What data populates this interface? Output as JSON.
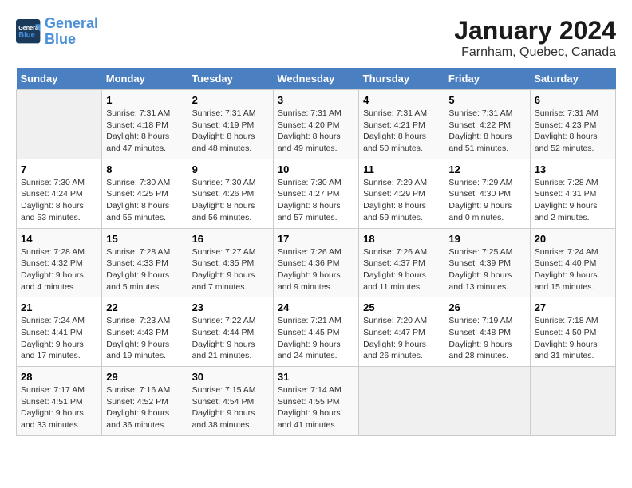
{
  "header": {
    "logo_line1": "General",
    "logo_line2": "Blue",
    "title": "January 2024",
    "subtitle": "Farnham, Quebec, Canada"
  },
  "weekdays": [
    "Sunday",
    "Monday",
    "Tuesday",
    "Wednesday",
    "Thursday",
    "Friday",
    "Saturday"
  ],
  "weeks": [
    [
      {
        "num": "",
        "info": ""
      },
      {
        "num": "1",
        "info": "Sunrise: 7:31 AM\nSunset: 4:18 PM\nDaylight: 8 hours\nand 47 minutes."
      },
      {
        "num": "2",
        "info": "Sunrise: 7:31 AM\nSunset: 4:19 PM\nDaylight: 8 hours\nand 48 minutes."
      },
      {
        "num": "3",
        "info": "Sunrise: 7:31 AM\nSunset: 4:20 PM\nDaylight: 8 hours\nand 49 minutes."
      },
      {
        "num": "4",
        "info": "Sunrise: 7:31 AM\nSunset: 4:21 PM\nDaylight: 8 hours\nand 50 minutes."
      },
      {
        "num": "5",
        "info": "Sunrise: 7:31 AM\nSunset: 4:22 PM\nDaylight: 8 hours\nand 51 minutes."
      },
      {
        "num": "6",
        "info": "Sunrise: 7:31 AM\nSunset: 4:23 PM\nDaylight: 8 hours\nand 52 minutes."
      }
    ],
    [
      {
        "num": "7",
        "info": "Sunrise: 7:30 AM\nSunset: 4:24 PM\nDaylight: 8 hours\nand 53 minutes."
      },
      {
        "num": "8",
        "info": "Sunrise: 7:30 AM\nSunset: 4:25 PM\nDaylight: 8 hours\nand 55 minutes."
      },
      {
        "num": "9",
        "info": "Sunrise: 7:30 AM\nSunset: 4:26 PM\nDaylight: 8 hours\nand 56 minutes."
      },
      {
        "num": "10",
        "info": "Sunrise: 7:30 AM\nSunset: 4:27 PM\nDaylight: 8 hours\nand 57 minutes."
      },
      {
        "num": "11",
        "info": "Sunrise: 7:29 AM\nSunset: 4:29 PM\nDaylight: 8 hours\nand 59 minutes."
      },
      {
        "num": "12",
        "info": "Sunrise: 7:29 AM\nSunset: 4:30 PM\nDaylight: 9 hours\nand 0 minutes."
      },
      {
        "num": "13",
        "info": "Sunrise: 7:28 AM\nSunset: 4:31 PM\nDaylight: 9 hours\nand 2 minutes."
      }
    ],
    [
      {
        "num": "14",
        "info": "Sunrise: 7:28 AM\nSunset: 4:32 PM\nDaylight: 9 hours\nand 4 minutes."
      },
      {
        "num": "15",
        "info": "Sunrise: 7:28 AM\nSunset: 4:33 PM\nDaylight: 9 hours\nand 5 minutes."
      },
      {
        "num": "16",
        "info": "Sunrise: 7:27 AM\nSunset: 4:35 PM\nDaylight: 9 hours\nand 7 minutes."
      },
      {
        "num": "17",
        "info": "Sunrise: 7:26 AM\nSunset: 4:36 PM\nDaylight: 9 hours\nand 9 minutes."
      },
      {
        "num": "18",
        "info": "Sunrise: 7:26 AM\nSunset: 4:37 PM\nDaylight: 9 hours\nand 11 minutes."
      },
      {
        "num": "19",
        "info": "Sunrise: 7:25 AM\nSunset: 4:39 PM\nDaylight: 9 hours\nand 13 minutes."
      },
      {
        "num": "20",
        "info": "Sunrise: 7:24 AM\nSunset: 4:40 PM\nDaylight: 9 hours\nand 15 minutes."
      }
    ],
    [
      {
        "num": "21",
        "info": "Sunrise: 7:24 AM\nSunset: 4:41 PM\nDaylight: 9 hours\nand 17 minutes."
      },
      {
        "num": "22",
        "info": "Sunrise: 7:23 AM\nSunset: 4:43 PM\nDaylight: 9 hours\nand 19 minutes."
      },
      {
        "num": "23",
        "info": "Sunrise: 7:22 AM\nSunset: 4:44 PM\nDaylight: 9 hours\nand 21 minutes."
      },
      {
        "num": "24",
        "info": "Sunrise: 7:21 AM\nSunset: 4:45 PM\nDaylight: 9 hours\nand 24 minutes."
      },
      {
        "num": "25",
        "info": "Sunrise: 7:20 AM\nSunset: 4:47 PM\nDaylight: 9 hours\nand 26 minutes."
      },
      {
        "num": "26",
        "info": "Sunrise: 7:19 AM\nSunset: 4:48 PM\nDaylight: 9 hours\nand 28 minutes."
      },
      {
        "num": "27",
        "info": "Sunrise: 7:18 AM\nSunset: 4:50 PM\nDaylight: 9 hours\nand 31 minutes."
      }
    ],
    [
      {
        "num": "28",
        "info": "Sunrise: 7:17 AM\nSunset: 4:51 PM\nDaylight: 9 hours\nand 33 minutes."
      },
      {
        "num": "29",
        "info": "Sunrise: 7:16 AM\nSunset: 4:52 PM\nDaylight: 9 hours\nand 36 minutes."
      },
      {
        "num": "30",
        "info": "Sunrise: 7:15 AM\nSunset: 4:54 PM\nDaylight: 9 hours\nand 38 minutes."
      },
      {
        "num": "31",
        "info": "Sunrise: 7:14 AM\nSunset: 4:55 PM\nDaylight: 9 hours\nand 41 minutes."
      },
      {
        "num": "",
        "info": ""
      },
      {
        "num": "",
        "info": ""
      },
      {
        "num": "",
        "info": ""
      }
    ]
  ]
}
